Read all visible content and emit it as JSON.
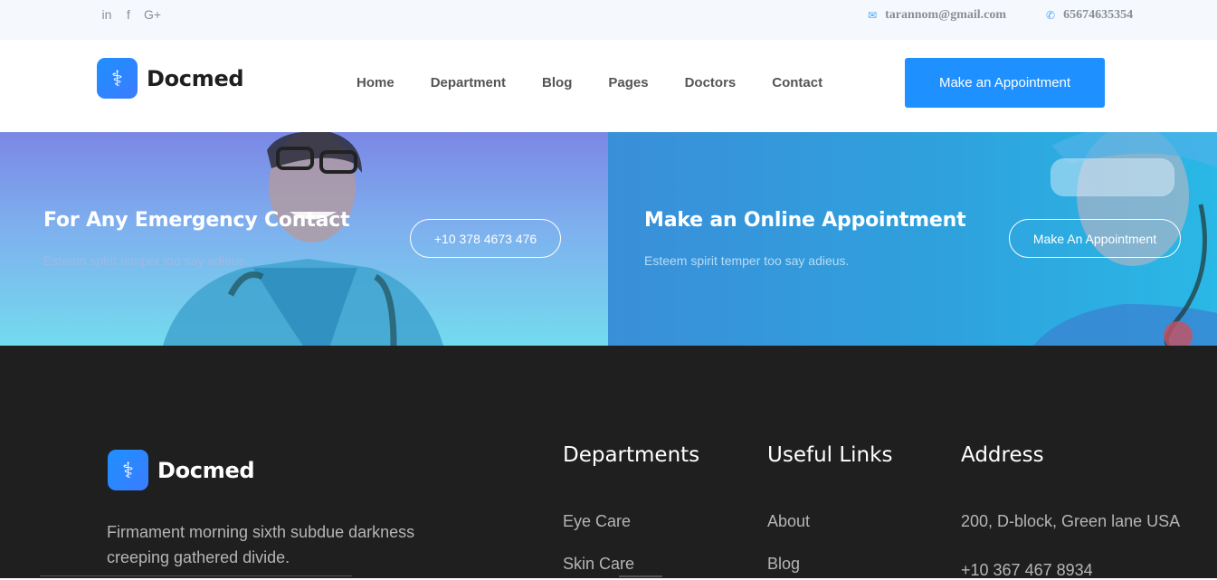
{
  "topbar": {
    "social": [
      {
        "icon": "linkedin-icon",
        "glyph": "in"
      },
      {
        "icon": "facebook-icon",
        "glyph": "f"
      },
      {
        "icon": "google-plus-icon",
        "glyph": "G+"
      }
    ],
    "email": "tarannom@gmail.com",
    "phone": "65674635354",
    "accent": "#4aa3ff"
  },
  "header": {
    "brand": "Docmed",
    "nav": [
      "Home",
      "Department",
      "Blog",
      "Pages",
      "Doctors",
      "Contact"
    ],
    "cta": "Make an Appointment",
    "accent": "#1e90ff"
  },
  "banners": {
    "emergency": {
      "title": "For Any Emergency Contact",
      "subtitle": "Esteem spirit temper too say adieus.",
      "button": "+10 378 4673 476"
    },
    "online": {
      "title": "Make an Online Appointment",
      "subtitle": "Esteem spirit temper too say adieus.",
      "button": "Make An Appointment"
    }
  },
  "footer": {
    "brand": "Docmed",
    "description": "Firmament morning sixth subdue darkness creeping gathered divide.",
    "columns": [
      {
        "title": "Departments",
        "links": [
          "Eye Care",
          "Skin Care"
        ]
      },
      {
        "title": "Useful Links",
        "links": [
          "About",
          "Blog"
        ]
      },
      {
        "title": "Address",
        "links": [
          "200, D-block, Green lane USA",
          "+10 367 467 8934"
        ]
      }
    ]
  }
}
